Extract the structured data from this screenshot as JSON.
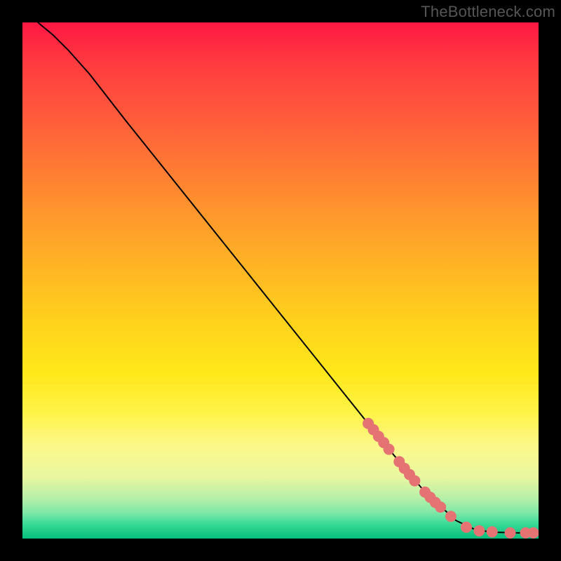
{
  "watermark": "TheBottleneck.com",
  "chart_data": {
    "type": "line",
    "title": "",
    "xlabel": "",
    "ylabel": "",
    "xlim": [
      0,
      100
    ],
    "ylim": [
      0,
      100
    ],
    "grid": false,
    "legend": false,
    "curve": {
      "comment": "x,y points in percent of plot area (0,0 bottom-left). Descending smooth curve.",
      "points": [
        {
          "x": 3.0,
          "y": 100.0
        },
        {
          "x": 6.0,
          "y": 97.5
        },
        {
          "x": 9.0,
          "y": 94.5
        },
        {
          "x": 13.0,
          "y": 90.0
        },
        {
          "x": 20.0,
          "y": 81.0
        },
        {
          "x": 30.0,
          "y": 68.5
        },
        {
          "x": 40.0,
          "y": 56.0
        },
        {
          "x": 50.0,
          "y": 43.5
        },
        {
          "x": 60.0,
          "y": 31.0
        },
        {
          "x": 70.0,
          "y": 18.5
        },
        {
          "x": 78.0,
          "y": 9.0
        },
        {
          "x": 84.0,
          "y": 3.5
        },
        {
          "x": 88.0,
          "y": 1.6
        },
        {
          "x": 92.0,
          "y": 1.2
        },
        {
          "x": 96.0,
          "y": 1.1
        },
        {
          "x": 99.0,
          "y": 1.1
        }
      ]
    },
    "markers": {
      "comment": "Visible salmon dot markers along the lower-right segment (x,y in percent).",
      "color": "#e57373",
      "radius": 8,
      "points": [
        {
          "x": 67.0,
          "y": 22.3
        },
        {
          "x": 68.0,
          "y": 21.1
        },
        {
          "x": 69.0,
          "y": 19.8
        },
        {
          "x": 70.0,
          "y": 18.6
        },
        {
          "x": 71.0,
          "y": 17.3
        },
        {
          "x": 73.0,
          "y": 14.9
        },
        {
          "x": 74.0,
          "y": 13.6
        },
        {
          "x": 75.0,
          "y": 12.4
        },
        {
          "x": 76.0,
          "y": 11.2
        },
        {
          "x": 78.0,
          "y": 9.0
        },
        {
          "x": 79.0,
          "y": 8.0
        },
        {
          "x": 80.0,
          "y": 7.0
        },
        {
          "x": 81.0,
          "y": 6.1
        },
        {
          "x": 83.0,
          "y": 4.3
        },
        {
          "x": 86.0,
          "y": 2.2
        },
        {
          "x": 88.5,
          "y": 1.5
        },
        {
          "x": 91.0,
          "y": 1.3
        },
        {
          "x": 94.5,
          "y": 1.1
        },
        {
          "x": 97.5,
          "y": 1.1
        },
        {
          "x": 99.0,
          "y": 1.1
        }
      ]
    }
  }
}
